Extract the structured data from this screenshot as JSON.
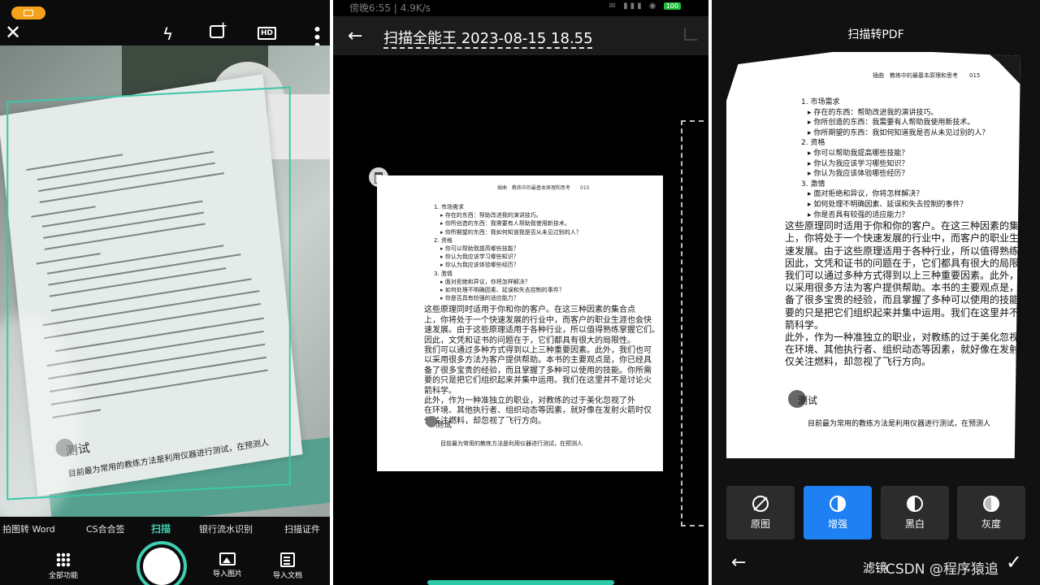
{
  "camera": {
    "top_icons": [
      "close-icon",
      "flash-icon",
      "add-image-icon",
      "hd-icon",
      "more-icon"
    ],
    "hd_label": "HD",
    "modes": [
      {
        "label": "拍图转 Word"
      },
      {
        "label": "CS合合签"
      },
      {
        "label": "扫描",
        "active": true
      },
      {
        "label": "银行流水识别"
      },
      {
        "label": "扫描证件"
      }
    ],
    "bottom": {
      "all_features": "全部功能",
      "import_image": "导入图片",
      "import_doc": "导入文档"
    },
    "book_title": "测试",
    "book_footer": "目前最为常用的教练方法是利用仪器进行测试，在预测人"
  },
  "viewer": {
    "status": {
      "time": "傍晚6:55 | 4.9K/s",
      "right": "✉ ▮▮▮ ◉",
      "battery": "100"
    },
    "title": "扫描全能王 2023-08-15 18.55"
  },
  "scan_doc": {
    "header": "插曲　教练中的最基本原理和思考　　015",
    "lines": [
      "1. 市场需求",
      "▸ 存在的东西：帮助改进我的演讲技巧。",
      "▸ 你所创造的东西：我需要有人帮助我使用新技术。",
      "▸ 你所期望的东西：我如何知道我是否从未见过别的人？",
      "2. 资格",
      "▸ 你可以帮助我提高哪些技能？",
      "▸ 你认为我应该学习哪些知识？",
      "▸ 你认为我应该体验哪些经历？",
      "3. 激情",
      "▸ 面对拒绝和异议，你将怎样解决？",
      "▸ 如何处理不明确因素、延误和失去控制的事件？",
      "▸ 你是否具有较强的适应能力？",
      "这些原理同时适用于你和你的客户。在这三种因素的集合点",
      "上，你将处于一个快速发展的行业中，而客户的职业生涯也会快",
      "速发展。由于这些原理适用于各种行业，所以值得熟练掌握它们。",
      "因此，文凭和证书的问题在于，它们都具有很大的局限性。",
      "我们可以通过多种方式得到以上三种重要因素。此外，我们也可",
      "以采用很多方法为客户提供帮助。本书的主要观点是，你已经具",
      "备了很多宝贵的经验，而且掌握了多种可以使用的技能。你所需",
      "要的只是把它们组织起来并集中运用。我们在这里并不是讨论火",
      "箭科学。",
      "此外，作为一种准独立的职业，对教练的过于美化忽视了外",
      "在环境、其他执行者、组织动态等因素，就好像在发射火箭时仅",
      "仅关注燃料，却忽视了飞行方向。"
    ],
    "section_title": "测试",
    "footer": "目前最为常用的教练方法是利用仪器进行测试，在预测人"
  },
  "filter": {
    "title": "扫描转PDF",
    "options": [
      {
        "label": "原图",
        "icon": "no-filter-icon"
      },
      {
        "label": "增强",
        "icon": "enhance-icon",
        "active": true
      },
      {
        "label": "黑白",
        "icon": "black-white-icon"
      },
      {
        "label": "灰度",
        "icon": "grayscale-icon"
      }
    ],
    "bottom_label": "滤镜",
    "watermark": "CSDN @程序猿追"
  },
  "colors": {
    "accent_teal": "#3fd0b2",
    "accent_blue": "#1e80f3",
    "record_orange": "#f4a21c"
  }
}
